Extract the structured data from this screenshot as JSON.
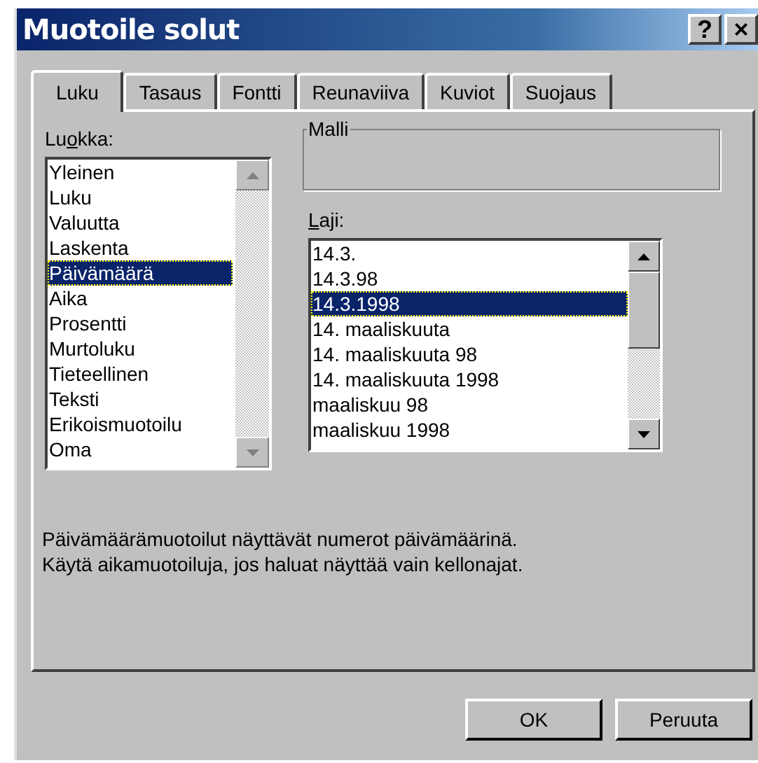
{
  "window": {
    "title": "Muotoile solut",
    "buttons": [
      "?",
      "×"
    ]
  },
  "tabs": [
    {
      "label": "Luku",
      "selected": true
    },
    {
      "label": "Tasaus",
      "selected": false
    },
    {
      "label": "Fontti",
      "selected": false
    },
    {
      "label": "Reunaviiva",
      "selected": false
    },
    {
      "label": "Kuviot",
      "selected": false
    },
    {
      "label": "Suojaus",
      "selected": false
    }
  ],
  "category": {
    "label": {
      "before": "Lu",
      "key": "o",
      "after": "kka:"
    },
    "items": [
      {
        "label": "Yleinen",
        "selected": false
      },
      {
        "label": "Luku",
        "selected": false
      },
      {
        "label": "Valuutta",
        "selected": false
      },
      {
        "label": "Laskenta",
        "selected": false
      },
      {
        "label": "Päivämäärä",
        "selected": true
      },
      {
        "label": "Aika",
        "selected": false
      },
      {
        "label": "Prosentti",
        "selected": false
      },
      {
        "label": "Murtoluku",
        "selected": false
      },
      {
        "label": "Tieteellinen",
        "selected": false
      },
      {
        "label": "Teksti",
        "selected": false
      },
      {
        "label": "Erikoismuotoilu",
        "selected": false
      },
      {
        "label": "Oma",
        "selected": false
      }
    ]
  },
  "sample": {
    "label": "Malli"
  },
  "type": {
    "label": {
      "key": "L",
      "after": "aji:"
    },
    "items": [
      {
        "label": "14.3.",
        "selected": false
      },
      {
        "label": "14.3.98",
        "selected": false
      },
      {
        "label": "14.3.1998",
        "selected": true
      },
      {
        "label": "14. maaliskuuta",
        "selected": false
      },
      {
        "label": "14. maaliskuuta 98",
        "selected": false
      },
      {
        "label": "14. maaliskuuta 1998",
        "selected": false
      },
      {
        "label": "maaliskuu 98",
        "selected": false
      },
      {
        "label": "maaliskuu 1998",
        "selected": false
      }
    ]
  },
  "description": [
    "Päivämäärämuotoilut näyttävät numerot päivämäärinä.",
    "Käytä aikamuotoiluja, jos haluat näyttää vain kellonajat."
  ],
  "buttons": [
    "OK",
    "Peruuta"
  ]
}
